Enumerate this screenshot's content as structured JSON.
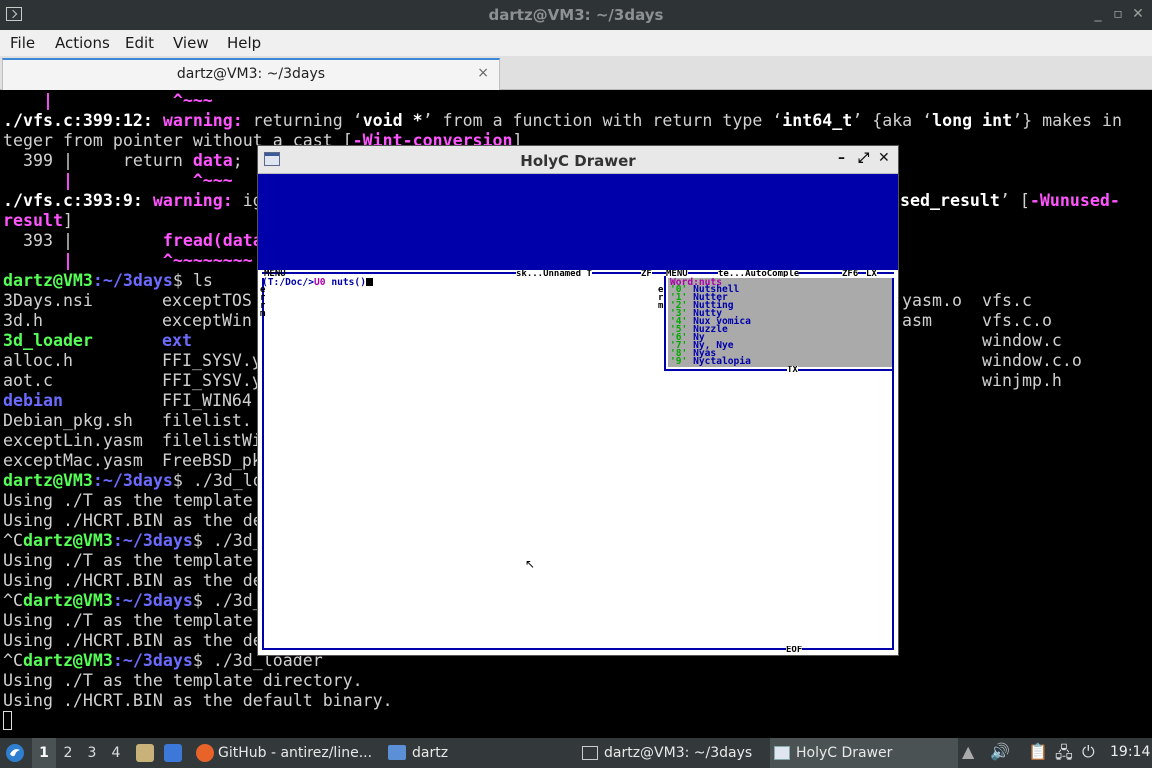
{
  "terminal_window": {
    "title": "dartz@VM3: ~/3days",
    "menu": [
      "File",
      "Actions",
      "Edit",
      "View",
      "Help"
    ],
    "tab_label": "dartz@VM3: ~/3days",
    "tab_close": "×",
    "minimize": "_",
    "restore": "▫",
    "close": "✕"
  },
  "terminal": {
    "l0": "    |            ^~~~",
    "l1a": "./vfs.c:399:12: ",
    "l1b": "warning: ",
    "l1c": "returning ‘",
    "l1d": "void *",
    "l1e": "’ from a function with return type ‘",
    "l1f": "int64_t",
    "l1g": "’ {aka ‘",
    "l1h": "long int",
    "l1i": "’} makes in",
    "l2a": "teger from pointer without a cast [",
    "l2b": "-Wint-conversion",
    "l2c": "]",
    "l3a": "  399 |     return ",
    "l3b": "data",
    "l3c": ";",
    "l4": "      |            ^~~~",
    "l5a": "./vfs.c:393:9: ",
    "l5b": "warning: ",
    "l5c": "ig",
    "l5d": "sed_result",
    "l5e": "’ [",
    "l5f": "-Wunused-",
    "l6a": "result",
    "l6b": "]",
    "l7a": "  393 |         ",
    "l7b": "fread(data",
    "l8": "      |         ^~~~~~~~~",
    "prompt_user": "dartz@VM3",
    "prompt_path": ":~/3days",
    "prompt_ls": "$ ls",
    "ls_rows": [
      [
        "3Days.nsi",
        "exceptTOS",
        "yasm.o",
        "vfs.c"
      ],
      [
        "3d.h",
        "exceptWin",
        "asm",
        "vfs.c.o"
      ],
      [
        "3d_loader",
        "ext",
        "",
        "window.c"
      ],
      [
        "alloc.h",
        "FFI_SYSV.y",
        "",
        "window.c.o"
      ],
      [
        "aot.c",
        "FFI_SYSV.y",
        "",
        "winjmp.h"
      ],
      [
        "debian",
        "FFI_WIN64",
        "",
        ""
      ],
      [
        "Debian_pkg.sh",
        "filelist.",
        "",
        ""
      ],
      [
        "exceptLin.yasm",
        "filelistWi",
        "",
        ""
      ],
      [
        "exceptMac.yasm",
        "FreeBSD_pk",
        "",
        ""
      ]
    ],
    "cmd_loader_cut": "$ ./3d_lo",
    "using_t_cut": "Using ./T as the template",
    "using_hcrt_cut": "Using ./HCRT.BIN as the de",
    "ctrl_c": "^C",
    "cmd_loader_cut2": "$ ./3d_",
    "cmd_loader_full": "$ ./3d_loader",
    "using_t_full": "Using ./T as the template directory.",
    "using_hcrt_full": "Using ./HCRT.BIN as the default binary."
  },
  "holyc": {
    "title": "HolyC Drawer",
    "btn_min": "–",
    "btn_max": "⤢",
    "btn_close": "✕",
    "menu_left": "MENU",
    "doc_title": "sk...Unnamed T",
    "doc_title_end": "ZF",
    "menu_right": "MENU",
    "ac_title": "te...AutoComple",
    "ac_title_end": "ZF6",
    "ac_title_x": "LX",
    "prompt_dir": "(T:/Doc/>",
    "prompt_u0": "U0 ",
    "prompt_cmd": "nuts()",
    "side_left": "e\nr\nr\nm",
    "side_right": "e\nr\nm",
    "ac_word": "Word:nuts",
    "ac_items": [
      {
        "key": "'0'",
        "word": "Nutshell"
      },
      {
        "key": "'1'",
        "word": "Nutter"
      },
      {
        "key": "'2'",
        "word": "Nutting"
      },
      {
        "key": "'3'",
        "word": "Nutty"
      },
      {
        "key": "'4'",
        "word": "Nux vomica"
      },
      {
        "key": "'5'",
        "word": "Nuzzle"
      },
      {
        "key": "'6'",
        "word": "Ny"
      },
      {
        "key": "'7'",
        "word": "Ny, Nye"
      },
      {
        "key": "'8'",
        "word": "Nyas"
      },
      {
        "key": "'9'",
        "word": "Nyctalopia"
      }
    ],
    "tx_label": "TX",
    "eof_label": "EOF"
  },
  "taskbar": {
    "workspaces": [
      "1",
      "2",
      "3",
      "4"
    ],
    "active_workspace": "1",
    "browser_window": "GitHub - antirez/line...",
    "files_window": "dartz",
    "terminal_window": "dartz@VM3: ~/3days",
    "holyc_window": "HolyC Drawer",
    "clock": "19:14"
  },
  "colors": {
    "tos_blue": "#0000aa",
    "tos_purple": "#aa00aa",
    "tos_green": "#00aa00",
    "tos_gray": "#aaaaaa",
    "warning_magenta": "#ff55ff",
    "prompt_green": "#55ff55",
    "dir_blue": "#6b6bff"
  }
}
